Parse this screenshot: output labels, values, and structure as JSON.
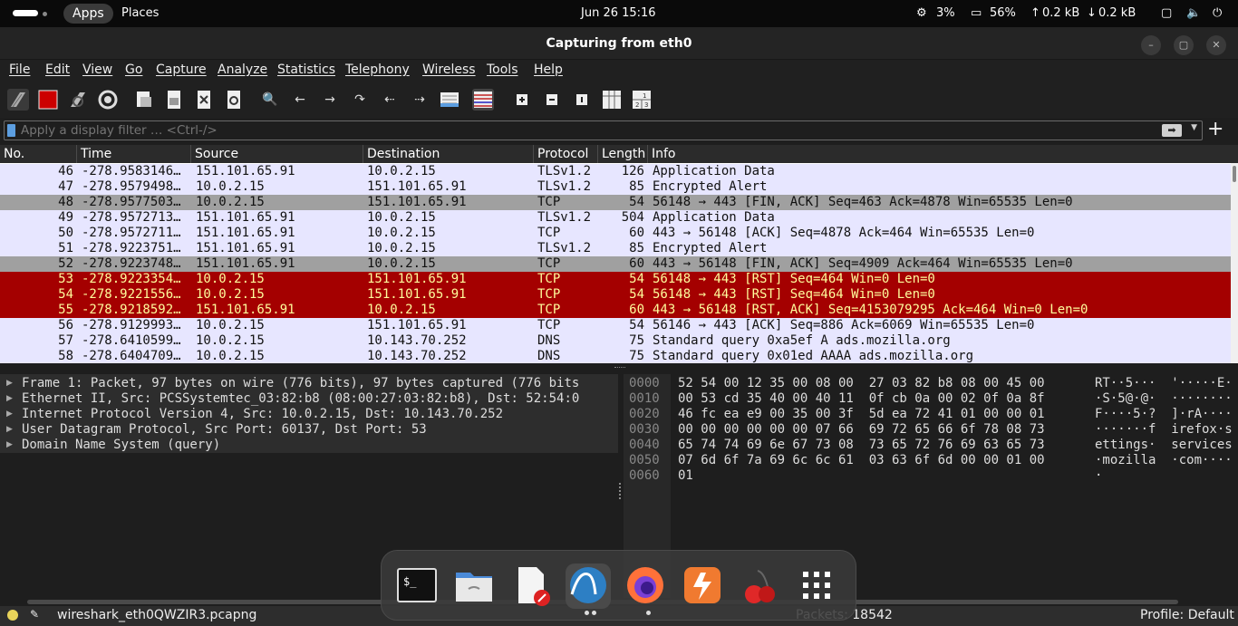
{
  "topbar": {
    "apps": "Apps",
    "places": "Places",
    "clock": "Jun 26  15:16",
    "cpu": "3%",
    "mem": "56%",
    "up": "0.2 kB",
    "down": "0.2 kB"
  },
  "window": {
    "title": "Capturing from eth0"
  },
  "menu": [
    "File",
    "Edit",
    "View",
    "Go",
    "Capture",
    "Analyze",
    "Statistics",
    "Telephony",
    "Wireless",
    "Tools",
    "Help"
  ],
  "filter": {
    "placeholder": "Apply a display filter … <Ctrl-/>"
  },
  "packet_list": {
    "columns": [
      "No.",
      "Time",
      "Source",
      "Destination",
      "Protocol",
      "Length",
      "Info"
    ],
    "rows": [
      {
        "no": "46",
        "time": "-278.9583146…",
        "src": "151.101.65.91",
        "dst": "10.0.2.15",
        "proto": "TLSv1.2",
        "len": "126",
        "info": "Application Data",
        "style": "tls"
      },
      {
        "no": "47",
        "time": "-278.9579498…",
        "src": "10.0.2.15",
        "dst": "151.101.65.91",
        "proto": "TLSv1.2",
        "len": "85",
        "info": "Encrypted Alert",
        "style": "tls"
      },
      {
        "no": "48",
        "time": "-278.9577503…",
        "src": "10.0.2.15",
        "dst": "151.101.65.91",
        "proto": "TCP",
        "len": "54",
        "info": "56148 → 443 [FIN, ACK] Seq=463 Ack=4878 Win=65535 Len=0",
        "style": "fin"
      },
      {
        "no": "49",
        "time": "-278.9572713…",
        "src": "151.101.65.91",
        "dst": "10.0.2.15",
        "proto": "TLSv1.2",
        "len": "504",
        "info": "Application Data",
        "style": "tls"
      },
      {
        "no": "50",
        "time": "-278.9572711…",
        "src": "151.101.65.91",
        "dst": "10.0.2.15",
        "proto": "TCP",
        "len": "60",
        "info": "443 → 56148 [ACK] Seq=4878 Ack=464 Win=65535 Len=0",
        "style": "tcp"
      },
      {
        "no": "51",
        "time": "-278.9223751…",
        "src": "151.101.65.91",
        "dst": "10.0.2.15",
        "proto": "TLSv1.2",
        "len": "85",
        "info": "Encrypted Alert",
        "style": "tls"
      },
      {
        "no": "52",
        "time": "-278.9223748…",
        "src": "151.101.65.91",
        "dst": "10.0.2.15",
        "proto": "TCP",
        "len": "60",
        "info": "443 → 56148 [FIN, ACK] Seq=4909 Ack=464 Win=65535 Len=0",
        "style": "fin"
      },
      {
        "no": "53",
        "time": "-278.9223354…",
        "src": "10.0.2.15",
        "dst": "151.101.65.91",
        "proto": "TCP",
        "len": "54",
        "info": "56148 → 443 [RST] Seq=464 Win=0 Len=0",
        "style": "rst"
      },
      {
        "no": "54",
        "time": "-278.9221556…",
        "src": "10.0.2.15",
        "dst": "151.101.65.91",
        "proto": "TCP",
        "len": "54",
        "info": "56148 → 443 [RST] Seq=464 Win=0 Len=0",
        "style": "rst"
      },
      {
        "no": "55",
        "time": "-278.9218592…",
        "src": "151.101.65.91",
        "dst": "10.0.2.15",
        "proto": "TCP",
        "len": "60",
        "info": "443 → 56148 [RST, ACK] Seq=4153079295 Ack=464 Win=0 Len=0",
        "style": "rst"
      },
      {
        "no": "56",
        "time": "-278.9129993…",
        "src": "10.0.2.15",
        "dst": "151.101.65.91",
        "proto": "TCP",
        "len": "54",
        "info": "56146 → 443 [ACK] Seq=886 Ack=6069 Win=65535 Len=0",
        "style": "tcp"
      },
      {
        "no": "57",
        "time": "-278.6410599…",
        "src": "10.0.2.15",
        "dst": "10.143.70.252",
        "proto": "DNS",
        "len": "75",
        "info": "Standard query 0xa5ef A ads.mozilla.org",
        "style": "dns"
      },
      {
        "no": "58",
        "time": "-278.6404709…",
        "src": "10.0.2.15",
        "dst": "10.143.70.252",
        "proto": "DNS",
        "len": "75",
        "info": "Standard query 0x01ed AAAA ads.mozilla.org",
        "style": "dns"
      }
    ]
  },
  "details": [
    "Frame 1: Packet, 97 bytes on wire (776 bits), 97 bytes captured (776 bits",
    "Ethernet II, Src: PCSSystemtec_03:82:b8 (08:00:27:03:82:b8), Dst: 52:54:0",
    "Internet Protocol Version 4, Src: 10.0.2.15, Dst: 10.143.70.252",
    "User Datagram Protocol, Src Port: 60137, Dst Port: 53",
    "Domain Name System (query)"
  ],
  "hex": [
    {
      "off": "0000",
      "hex": "52 54 00 12 35 00 08 00  27 03 82 b8 08 00 45 00",
      "ascii": "RT··5···  '·····E·"
    },
    {
      "off": "0010",
      "hex": "00 53 cd 35 40 00 40 11  0f cb 0a 00 02 0f 0a 8f",
      "ascii": "·S·5@·@·  ········"
    },
    {
      "off": "0020",
      "hex": "46 fc ea e9 00 35 00 3f  5d ea 72 41 01 00 00 01",
      "ascii": "F····5·?  ]·rA····"
    },
    {
      "off": "0030",
      "hex": "00 00 00 00 00 00 07 66  69 72 65 66 6f 78 08 73",
      "ascii": "·······f  irefox·s"
    },
    {
      "off": "0040",
      "hex": "65 74 74 69 6e 67 73 08  73 65 72 76 69 63 65 73",
      "ascii": "ettings·  services"
    },
    {
      "off": "0050",
      "hex": "07 6d 6f 7a 69 6c 6c 61  03 63 6f 6d 00 00 01 00",
      "ascii": "·mozilla  ·com····"
    },
    {
      "off": "0060",
      "hex": "01",
      "ascii": "·"
    }
  ],
  "status": {
    "file": "wireshark_eth0QWZIR3.pcapng",
    "packets": "Packets: 18542",
    "profile": "Profile: Default"
  },
  "colors": {
    "row_normal": "#e7e6ff",
    "row_fin": "#a0a0a0",
    "row_rst": "#a40000",
    "rst_text": "#fffc9c"
  }
}
